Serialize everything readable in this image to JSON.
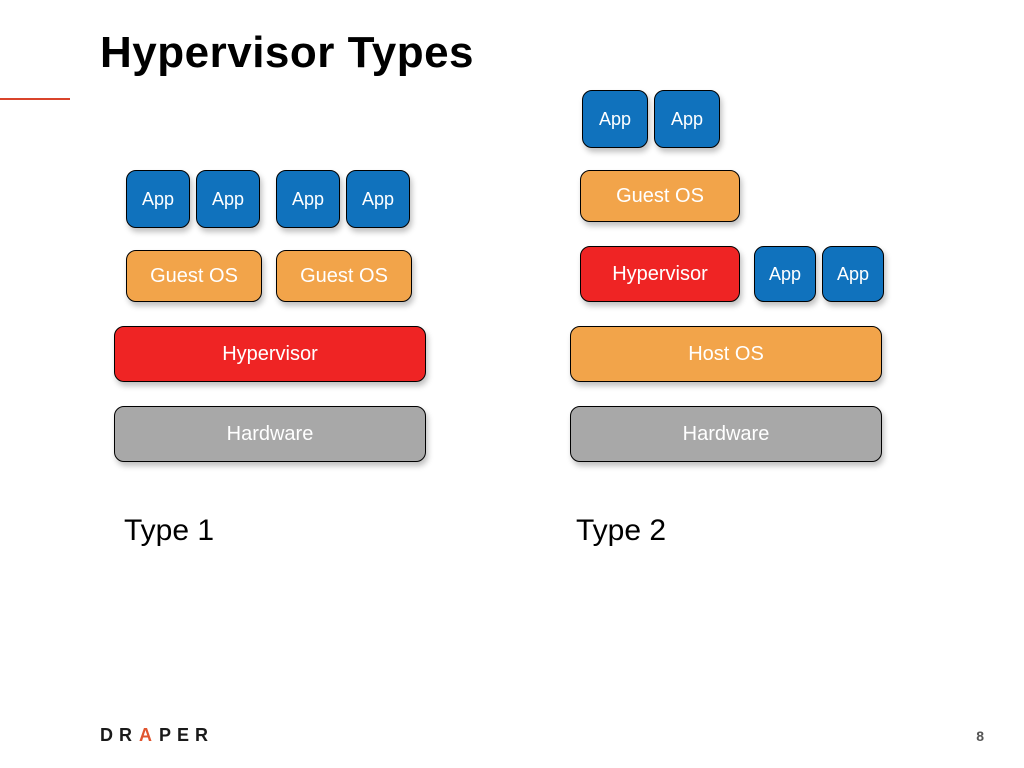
{
  "title": "Hypervisor Types",
  "page_number": "8",
  "logo": {
    "d": "D",
    "r1": "R",
    "a": "A",
    "p": "P",
    "e": "E",
    "r2": "R"
  },
  "type1": {
    "caption": "Type 1",
    "apps": [
      "App",
      "App",
      "App",
      "App"
    ],
    "guest_os": [
      "Guest OS",
      "Guest OS"
    ],
    "hypervisor": "Hypervisor",
    "hardware": "Hardware"
  },
  "type2": {
    "caption": "Type 2",
    "top_apps": [
      "App",
      "App"
    ],
    "guest_os": "Guest OS",
    "hypervisor": "Hypervisor",
    "side_apps": [
      "App",
      "App"
    ],
    "host_os": "Host OS",
    "hardware": "Hardware"
  }
}
